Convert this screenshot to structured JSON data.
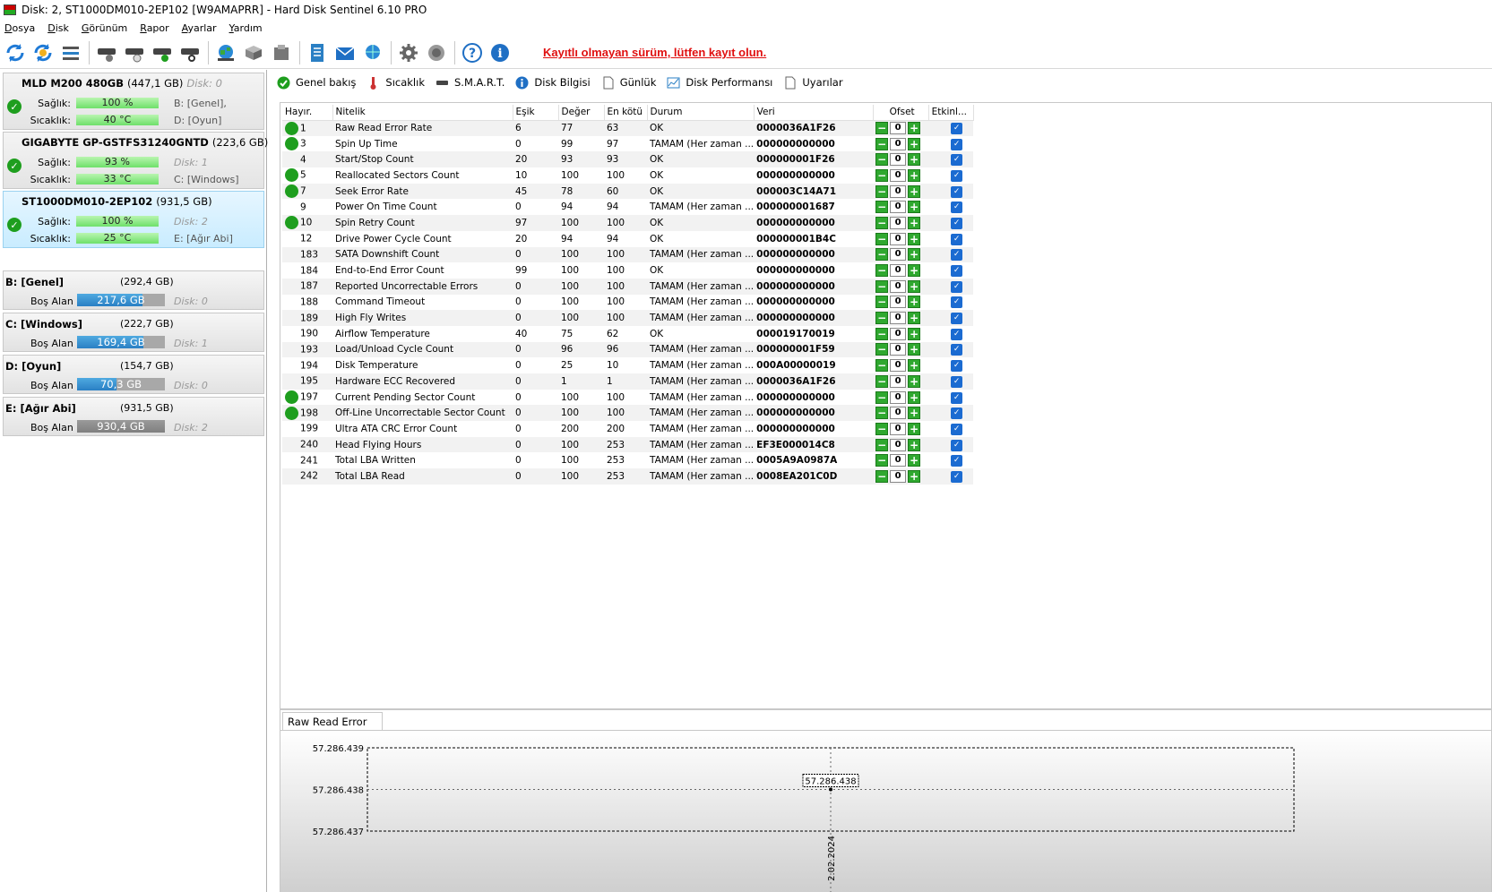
{
  "window": {
    "title": "Disk: 2, ST1000DM010-2EP102 [W9AMAPRR]  -  Hard Disk Sentinel 6.10 PRO"
  },
  "menu": [
    "Dosya",
    "Disk",
    "Görünüm",
    "Rapor",
    "Ayarlar",
    "Yardım"
  ],
  "toolbar": {
    "warning": "Kayıtlı olmayan sürüm, lütfen kayıt olun."
  },
  "disks": [
    {
      "name": "MLD M200 480GB",
      "size": "(447,1 GB)",
      "disk": "Disk: 0",
      "health_label": "Sağlık:",
      "health": "100 %",
      "temp_label": "Sıcaklık:",
      "temp": "40 °C",
      "part1": "B: [Genel],",
      "part2": "D: [Oyun]"
    },
    {
      "name": "GIGABYTE GP-GSTFS31240GNTD",
      "size": "(223,6 GB)",
      "disk": "",
      "health_label": "Sağlık:",
      "health": "93 %",
      "temp_label": "Sıcaklık:",
      "temp": "33 °C",
      "part1": "Disk: 1",
      "part2": "C: [Windows]"
    },
    {
      "name": "ST1000DM010-2EP102",
      "size": "(931,5 GB)",
      "disk": "",
      "health_label": "Sağlık:",
      "health": "100 %",
      "temp_label": "Sıcaklık:",
      "temp": "25 °C",
      "part1": "Disk: 2",
      "part2": "E: [Ağır Abi]"
    }
  ],
  "volumes": [
    {
      "name": "B: [Genel]",
      "size": "(292,4 GB)",
      "free_label": "Boş Alan",
      "free": "217,6 GB",
      "free_pct": 74,
      "disk": "Disk: 0"
    },
    {
      "name": "C: [Windows]",
      "size": "(222,7 GB)",
      "free_label": "Boş Alan",
      "free": "169,4 GB",
      "free_pct": 76,
      "disk": "Disk: 1"
    },
    {
      "name": "D: [Oyun]",
      "size": "(154,7 GB)",
      "free_label": "Boş Alan",
      "free": "70,3 GB",
      "free_pct": 45,
      "disk": "Disk: 0"
    },
    {
      "name": "E: [Ağır Abi]",
      "size": "(931,5 GB)",
      "free_label": "Boş Alan",
      "free": "930,4 GB",
      "free_pct": 100,
      "disk": "Disk: 2"
    }
  ],
  "tabs": [
    "Genel bakış",
    "Sıcaklık",
    "S.M.A.R.T.",
    "Disk Bilgisi",
    "Günlük",
    "Disk Performansı",
    "Uyarılar"
  ],
  "smart": {
    "columns": [
      "Hayır.",
      "Nitelik",
      "Eşik",
      "Değer",
      "En kötü",
      "Durum",
      "Veri",
      "Ofset",
      "Etkinl..."
    ],
    "rows": [
      {
        "ok": true,
        "id": "1",
        "name": "Raw Read Error Rate",
        "thr": "6",
        "val": "77",
        "worst": "63",
        "status": "OK",
        "data": "0000036A1F26",
        "offset": "0"
      },
      {
        "ok": true,
        "id": "3",
        "name": "Spin Up Time",
        "thr": "0",
        "val": "99",
        "worst": "97",
        "status": "TAMAM (Her zaman ...",
        "data": "000000000000",
        "offset": "0"
      },
      {
        "ok": false,
        "id": "4",
        "name": "Start/Stop Count",
        "thr": "20",
        "val": "93",
        "worst": "93",
        "status": "OK",
        "data": "000000001F26",
        "offset": "0"
      },
      {
        "ok": true,
        "id": "5",
        "name": "Reallocated Sectors Count",
        "thr": "10",
        "val": "100",
        "worst": "100",
        "status": "OK",
        "data": "000000000000",
        "offset": "0"
      },
      {
        "ok": true,
        "id": "7",
        "name": "Seek Error Rate",
        "thr": "45",
        "val": "78",
        "worst": "60",
        "status": "OK",
        "data": "000003C14A71",
        "offset": "0"
      },
      {
        "ok": false,
        "id": "9",
        "name": "Power On Time Count",
        "thr": "0",
        "val": "94",
        "worst": "94",
        "status": "TAMAM (Her zaman ...",
        "data": "000000001687",
        "offset": "0"
      },
      {
        "ok": true,
        "id": "10",
        "name": "Spin Retry Count",
        "thr": "97",
        "val": "100",
        "worst": "100",
        "status": "OK",
        "data": "000000000000",
        "offset": "0"
      },
      {
        "ok": false,
        "id": "12",
        "name": "Drive Power Cycle Count",
        "thr": "20",
        "val": "94",
        "worst": "94",
        "status": "OK",
        "data": "000000001B4C",
        "offset": "0"
      },
      {
        "ok": false,
        "id": "183",
        "name": "SATA Downshift Count",
        "thr": "0",
        "val": "100",
        "worst": "100",
        "status": "TAMAM (Her zaman ...",
        "data": "000000000000",
        "offset": "0"
      },
      {
        "ok": false,
        "id": "184",
        "name": "End-to-End Error Count",
        "thr": "99",
        "val": "100",
        "worst": "100",
        "status": "OK",
        "data": "000000000000",
        "offset": "0"
      },
      {
        "ok": false,
        "id": "187",
        "name": "Reported Uncorrectable Errors",
        "thr": "0",
        "val": "100",
        "worst": "100",
        "status": "TAMAM (Her zaman ...",
        "data": "000000000000",
        "offset": "0"
      },
      {
        "ok": false,
        "id": "188",
        "name": "Command Timeout",
        "thr": "0",
        "val": "100",
        "worst": "100",
        "status": "TAMAM (Her zaman ...",
        "data": "000000000000",
        "offset": "0"
      },
      {
        "ok": false,
        "id": "189",
        "name": "High Fly Writes",
        "thr": "0",
        "val": "100",
        "worst": "100",
        "status": "TAMAM (Her zaman ...",
        "data": "000000000000",
        "offset": "0"
      },
      {
        "ok": false,
        "id": "190",
        "name": "Airflow Temperature",
        "thr": "40",
        "val": "75",
        "worst": "62",
        "status": "OK",
        "data": "000019170019",
        "offset": "0"
      },
      {
        "ok": false,
        "id": "193",
        "name": "Load/Unload Cycle Count",
        "thr": "0",
        "val": "96",
        "worst": "96",
        "status": "TAMAM (Her zaman ...",
        "data": "000000001F59",
        "offset": "0"
      },
      {
        "ok": false,
        "id": "194",
        "name": "Disk Temperature",
        "thr": "0",
        "val": "25",
        "worst": "10",
        "status": "TAMAM (Her zaman ...",
        "data": "000A00000019",
        "offset": "0"
      },
      {
        "ok": false,
        "id": "195",
        "name": "Hardware ECC Recovered",
        "thr": "0",
        "val": "1",
        "worst": "1",
        "status": "TAMAM (Her zaman ...",
        "data": "0000036A1F26",
        "offset": "0"
      },
      {
        "ok": true,
        "id": "197",
        "name": "Current Pending Sector Count",
        "thr": "0",
        "val": "100",
        "worst": "100",
        "status": "TAMAM (Her zaman ...",
        "data": "000000000000",
        "offset": "0"
      },
      {
        "ok": true,
        "id": "198",
        "name": "Off-Line Uncorrectable Sector Count",
        "thr": "0",
        "val": "100",
        "worst": "100",
        "status": "TAMAM (Her zaman ...",
        "data": "000000000000",
        "offset": "0"
      },
      {
        "ok": false,
        "id": "199",
        "name": "Ultra ATA CRC Error Count",
        "thr": "0",
        "val": "200",
        "worst": "200",
        "status": "TAMAM (Her zaman ...",
        "data": "000000000000",
        "offset": "0"
      },
      {
        "ok": false,
        "id": "240",
        "name": "Head Flying Hours",
        "thr": "0",
        "val": "100",
        "worst": "253",
        "status": "TAMAM (Her zaman ...",
        "data": "EF3E000014C8",
        "offset": "0"
      },
      {
        "ok": false,
        "id": "241",
        "name": "Total LBA Written",
        "thr": "0",
        "val": "100",
        "worst": "253",
        "status": "TAMAM (Her zaman ...",
        "data": "0005A9A0987A",
        "offset": "0"
      },
      {
        "ok": false,
        "id": "242",
        "name": "Total LBA Read",
        "thr": "0",
        "val": "100",
        "worst": "253",
        "status": "TAMAM (Her zaman ...",
        "data": "0008EA201C0D",
        "offset": "0"
      }
    ]
  },
  "graph": {
    "tab_label": "Raw Read Error Rate",
    "chart_data": {
      "type": "line",
      "y_ticks": [
        "57.286.439",
        "57.286.438",
        "57.286.437"
      ],
      "ylim": [
        57286437,
        57286439
      ],
      "points": [
        {
          "x": "2.02.2024",
          "y": 57286438,
          "label": "57.286.438"
        }
      ],
      "x_ticks": [
        "2.02.2024"
      ],
      "grid": true
    }
  },
  "colors": {
    "ok": "#1e9e1e",
    "warning": "#e01010",
    "volume_fill": "#2a7fc4"
  }
}
